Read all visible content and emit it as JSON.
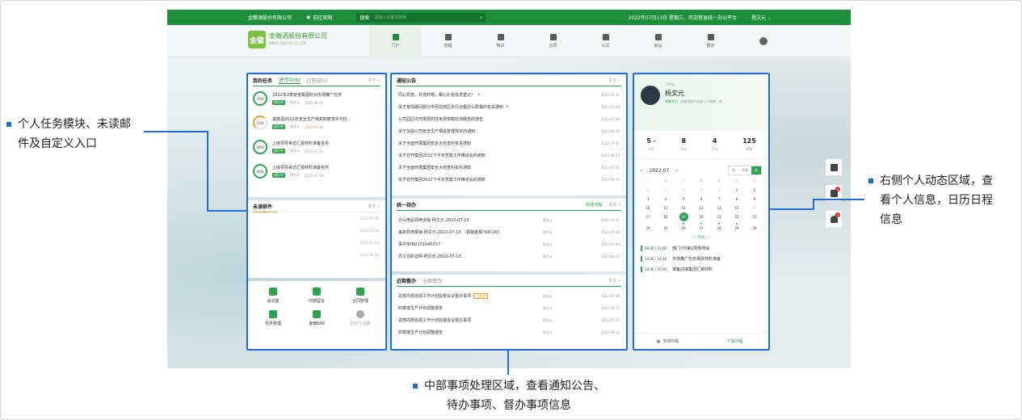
{
  "topbar": {
    "company": "金徽酒股份有限公司",
    "official_site": "前往官网",
    "search_scope": "搜索",
    "search_placeholder": "请输入关键词搜索",
    "date": "2022年07月13日 星期三，欢迎登录统一办公平台",
    "user": "杨文元"
  },
  "logo": {
    "mark": "金徽",
    "name": "金徽酒股份有限公司",
    "sub": "JINHUI LIQUOR CO.,LTD."
  },
  "nav": [
    "门户",
    "流程",
    "知识",
    "合同",
    "公文",
    "会议",
    "督办"
  ],
  "tasks": {
    "title": "我的任务",
    "tab_active": "进行中(6)",
    "tab_done": "已完成(1)",
    "more": "更多 >",
    "items": [
      {
        "pct": "35%",
        "title": "2022年3季度金徽酒杭州市场推广任务",
        "status": "进行中",
        "owner": "杨文元",
        "date": "2022-08-31",
        "ring": "green"
      },
      {
        "pct": "15%",
        "title": "金徽酒2022年安全生产相关制度落实与检...",
        "status": "进行中",
        "owner": "杨文元",
        "date": "2022-07-16",
        "ring": "orange"
      },
      {
        "pct": "00%",
        "title": "上级领导来访汇报材料准备任务",
        "status": "进行中",
        "owner": "杨文元",
        "date": "2022-07-31",
        "ring": "green"
      },
      {
        "pct": "00%",
        "title": "上级领导来访汇报材料准备任务",
        "status": "进行中",
        "owner": "杨文元",
        "date": "2022-07-28",
        "ring": "green"
      }
    ]
  },
  "mail": {
    "title": "未读邮件",
    "more": "更多 >",
    "dates": [
      "2022-07-11",
      "2022-07-08",
      "2022-07-04",
      "2022-06-24"
    ]
  },
  "apps": [
    "会议室",
    "内部留言",
    "合同管理",
    "任务管理",
    "金蝶EAS",
    "自定义设置"
  ],
  "notice": {
    "title": "通知公告",
    "more": "更多 >",
    "items": [
      {
        "t": "同心抗疫，共克时艰，暖心礼包信息登记！",
        "d": "2022-07-11",
        "dot": true
      },
      {
        "t": "关于疫情期间部分中风险地区实行远程办公政策的有关通知",
        "d": "2022-07-08",
        "dot": true
      },
      {
        "t": "公司园区内开展预防性免费核酸检测服务的通告",
        "d": "2022-07-04",
        "dot": false
      },
      {
        "t": "关于加强公司安全生产相关管理规定的通知",
        "d": "2022-06-24",
        "dot": false
      },
      {
        "t": "关于全面开展集团安全大检查的有关通知",
        "d": "2022-07-11",
        "dot": false
      },
      {
        "t": "关于召开集团2022下半年党建工作推进会的通知",
        "d": "2022-06-24",
        "dot": false
      },
      {
        "t": "关于全面开展集团安全大检查的有关通知",
        "d": "2022-07-11",
        "dot": false
      },
      {
        "t": "关于召开集团2022下半年党建工作推进会的通知",
        "d": "2022-06-24",
        "dot": false
      }
    ]
  },
  "todo": {
    "title": "统一待办",
    "new": "新建流程",
    "more": "更多 >",
    "items": [
      {
        "t": "办公用品领用流程-杨文元-2022-07-13",
        "w": "杨文元",
        "d": "2022-07-11"
      },
      {
        "t": "差旅费用报销-杨文元-2022-07-13 （报销金额:500.00)",
        "w": "杨文元",
        "d": "2022-07-08"
      },
      {
        "t": "事件单IN2201046027",
        "w": "杨文元",
        "d": "2022-07-04"
      },
      {
        "t": "员工在职证明-杨文元-2022-07-13",
        "w": "杨文元",
        "d": "2022-06-24"
      }
    ]
  },
  "supervise": {
    "title": "近期督办",
    "tab": "全部督办",
    "more": "更多 >",
    "items": [
      {
        "t": "总部内部巡视工作计划监督会议督办事项",
        "tag": "已超期",
        "w": "杨文元",
        "d": "2022-07-09"
      },
      {
        "t": "四季度生产计划调整报告",
        "tag": "",
        "w": "杨文元",
        "d": "2022-09-10"
      },
      {
        "t": "总部内部巡视工作计划监督会议督办事项",
        "tag": "",
        "w": "杨文元",
        "d": "2022-07-10"
      },
      {
        "t": "四季度生产计划调整报告",
        "tag": "",
        "w": "杨文元",
        "d": "2022-09-10"
      }
    ]
  },
  "profile": {
    "greet": "下午好,",
    "name": "杨文元",
    "role": "销售专员",
    "dept": "金徽酒股份有限公司销售一部",
    "stats": [
      {
        "n": "5",
        "l": "待办",
        "dot": true
      },
      {
        "n": "8",
        "l": "待阅",
        "dot": false
      },
      {
        "n": "4",
        "l": "任务",
        "dot": false
      },
      {
        "n": "125",
        "l": "微博",
        "dot": false
      }
    ]
  },
  "calendar": {
    "month": "2022.07",
    "modes": [
      "周",
      "双周",
      "月"
    ],
    "weekdays": [
      "一",
      "二",
      "三",
      "四",
      "五",
      "六",
      "日"
    ],
    "rows": [
      [
        "26",
        "27",
        "28",
        "29",
        "30",
        "1",
        "2"
      ],
      [
        "3",
        "4",
        "5",
        "6",
        "7",
        "8",
        "9"
      ],
      [
        "10",
        "11",
        "12",
        "13",
        "14",
        "15",
        "16"
      ],
      [
        "17",
        "18",
        "19",
        "20",
        "21",
        "22",
        "23"
      ],
      [
        "24",
        "25",
        "26",
        "27",
        "28",
        "29",
        "30"
      ]
    ],
    "today_label": "今天",
    "events": [
      {
        "tm": "09:30 - 11:00",
        "t": "部门7月第2周周例会"
      },
      {
        "tm": "13:00 - 14:30",
        "t": "市场推广任务相关材料准备"
      },
      {
        "tm": "14:30 - 16:00",
        "t": "准备迎接集团汇报材料"
      }
    ],
    "footer_left": "安排日程",
    "footer_right": "下属日程"
  },
  "sidebtns": [
    {
      "cnt": ""
    },
    {
      "cnt": "3"
    },
    {
      "cnt": "1"
    }
  ],
  "callouts": {
    "left": [
      "个人任务模块、未读邮",
      "件及自定义入口"
    ],
    "right": [
      "右侧个人动态区域，查",
      "看个人信息，日历日程",
      "信息"
    ],
    "bottom": [
      "中部事项处理区域，查看通知公告、",
      "待办事项、督办事项信息"
    ]
  }
}
